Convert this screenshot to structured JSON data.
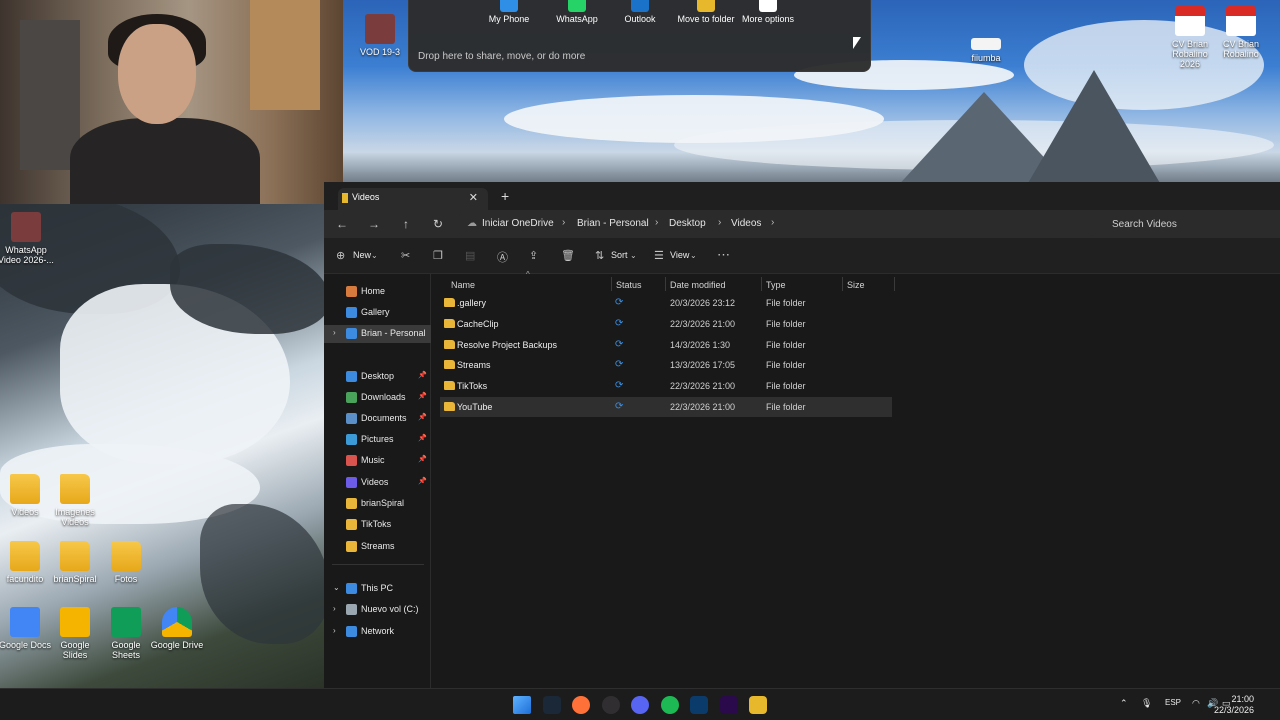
{
  "webcam": {
    "overlay_label": "VOD 19-3"
  },
  "desktop": {
    "icons": [
      {
        "label": "WhatsApp Video 2026-...",
        "icon": "video-thumbnail-icon"
      },
      {
        "label": "Videos",
        "icon": "folder-icon"
      },
      {
        "label": "Imagenes Videos",
        "icon": "folder-icon"
      },
      {
        "label": "facundito",
        "icon": "folder-icon"
      },
      {
        "label": "brianSpiral",
        "icon": "folder-icon"
      },
      {
        "label": "Fotos",
        "icon": "folder-icon"
      },
      {
        "label": "Google Docs",
        "icon": "google-docs-icon"
      },
      {
        "label": "Google Slides",
        "icon": "google-slides-icon"
      },
      {
        "label": "Google Sheets",
        "icon": "google-sheets-icon"
      },
      {
        "label": "Google Drive",
        "icon": "google-drive-icon"
      },
      {
        "label": "fiiumba",
        "icon": "file-icon"
      },
      {
        "label": "CV Brian Robalino 2026",
        "icon": "pdf-icon"
      },
      {
        "label": "CV Brian Robalino",
        "icon": "pdf-icon"
      }
    ]
  },
  "share": {
    "options": [
      {
        "label": "My Phone",
        "color": "#2f8fe6"
      },
      {
        "label": "WhatsApp",
        "color": "#25d366"
      },
      {
        "label": "Outlook",
        "color": "#1a73c9"
      },
      {
        "label": "Move to folder",
        "color": "#e7b72c"
      },
      {
        "label": "More options",
        "color": "#ffffff"
      }
    ],
    "hint": "Drop here to share, move, or do more"
  },
  "explorer": {
    "tab_label": "Videos",
    "tab_close": "✕",
    "new_tab": "+",
    "breadcrumbs": [
      "Iniciar OneDrive",
      "Brian - Personal",
      "Desktop",
      "Videos"
    ],
    "search_placeholder": "Search Videos",
    "commands": {
      "new": "New",
      "sort": "Sort",
      "view": "View"
    },
    "sidebar": [
      {
        "label": "Home",
        "pinned": false
      },
      {
        "label": "Gallery",
        "pinned": false
      },
      {
        "label": "Brian - Personal",
        "pinned": false
      },
      {
        "label": "Desktop",
        "pinned": true
      },
      {
        "label": "Downloads",
        "pinned": true
      },
      {
        "label": "Documents",
        "pinned": true
      },
      {
        "label": "Pictures",
        "pinned": true
      },
      {
        "label": "Music",
        "pinned": true
      },
      {
        "label": "Videos",
        "pinned": true
      },
      {
        "label": "brianSpiral",
        "pinned": false
      },
      {
        "label": "TikToks",
        "pinned": false
      },
      {
        "label": "Streams",
        "pinned": false
      },
      {
        "label": "This PC",
        "pinned": false
      },
      {
        "label": "Nuevo vol (C:)",
        "pinned": false
      },
      {
        "label": "Network",
        "pinned": false
      }
    ],
    "columns": [
      "Name",
      "Status",
      "Date modified",
      "Type",
      "Size"
    ],
    "files": [
      {
        "name": ".gallery",
        "date": "20/3/2026 23:12",
        "type": "File folder"
      },
      {
        "name": "CacheClip",
        "date": "22/3/2026 21:00",
        "type": "File folder"
      },
      {
        "name": "Resolve Project Backups",
        "date": "14/3/2026 1:30",
        "type": "File folder"
      },
      {
        "name": "Streams",
        "date": "13/3/2026 17:05",
        "type": "File folder"
      },
      {
        "name": "TikToks",
        "date": "22/3/2026 21:00",
        "type": "File folder"
      },
      {
        "name": "YouTube",
        "date": "22/3/2026 21:00",
        "type": "File folder"
      }
    ]
  },
  "taskbar": {
    "apps": [
      "start-icon",
      "steam-icon",
      "firefox-icon",
      "obs-icon",
      "discord-icon",
      "spotify-icon",
      "photoshop-icon",
      "premiere-icon",
      "file-explorer-icon"
    ],
    "language": "ESP",
    "time": "21:00",
    "date": "22/3/2026"
  }
}
